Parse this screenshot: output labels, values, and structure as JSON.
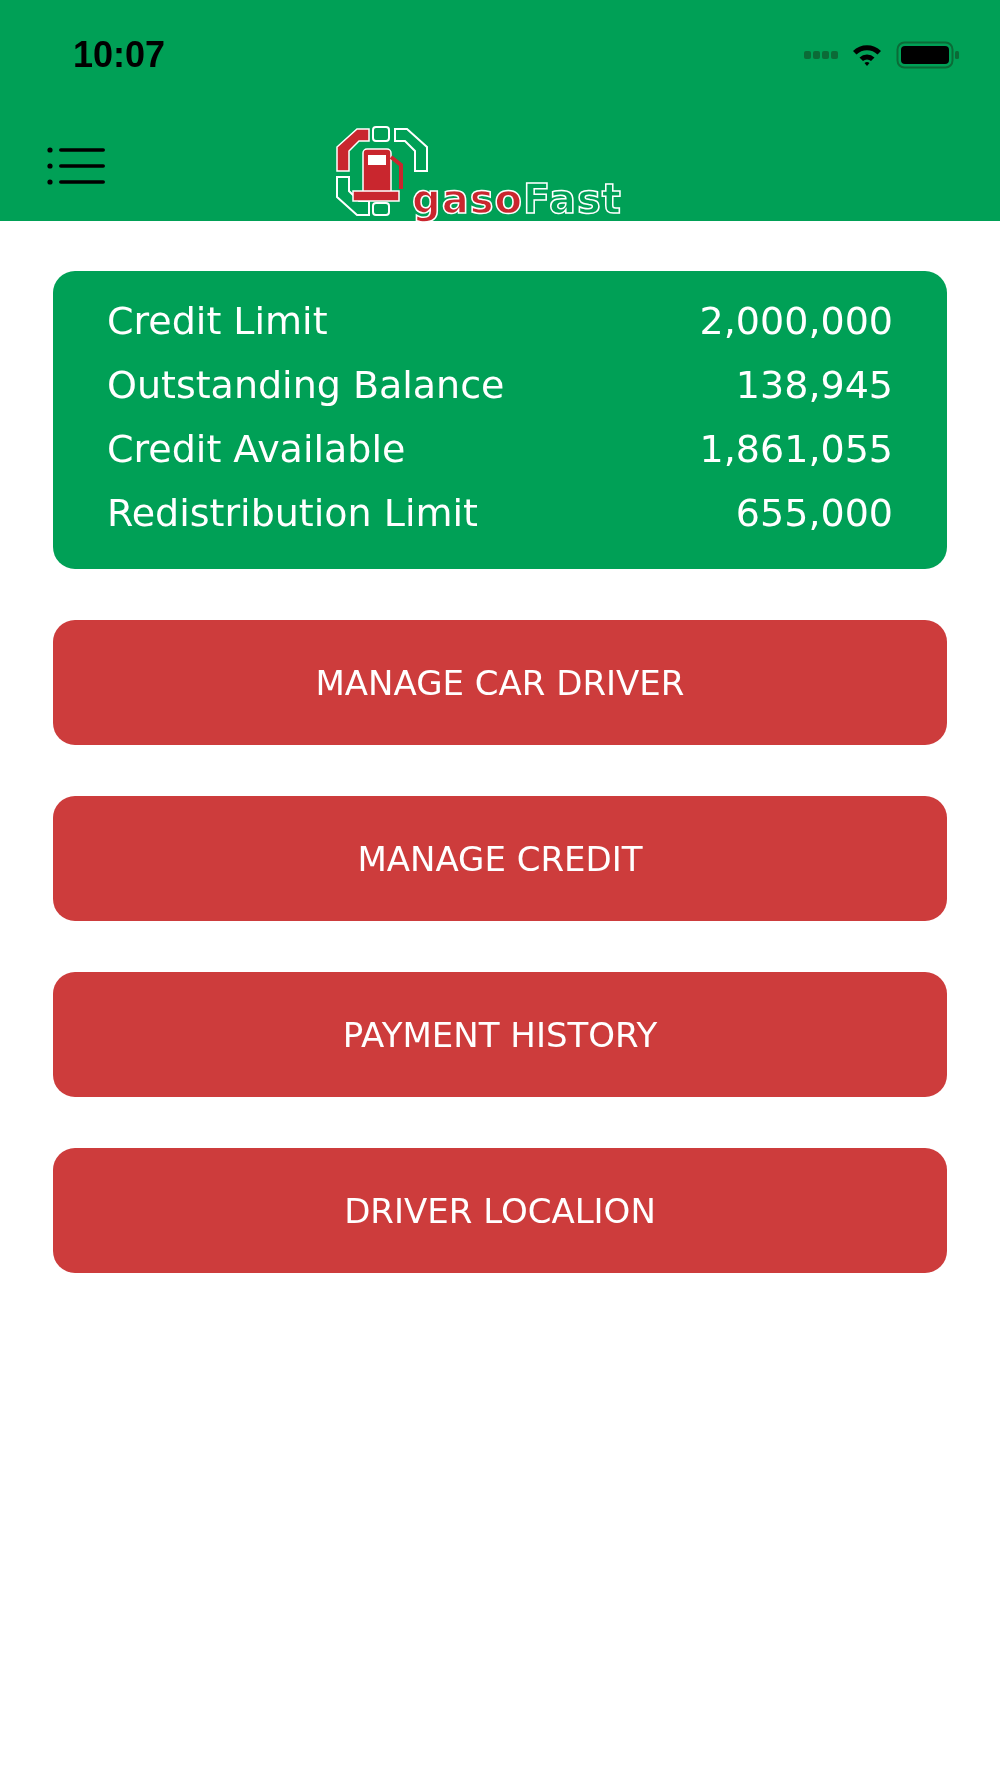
{
  "status_bar": {
    "time": "10:07"
  },
  "header": {
    "logo": {
      "part_1": "gaso",
      "part_2": "Fast"
    }
  },
  "summary": [
    {
      "label": "Credit Limit",
      "value": "2,000,000"
    },
    {
      "label": "Outstanding Balance",
      "value": "138,945"
    },
    {
      "label": "Credit Available",
      "value": "1,861,055"
    },
    {
      "label": "Redistribution Limit",
      "value": "655,000"
    }
  ],
  "buttons": [
    "MANAGE CAR DRIVER",
    "MANAGE CREDIT",
    "PAYMENT HISTORY",
    "DRIVER LOCALION"
  ]
}
